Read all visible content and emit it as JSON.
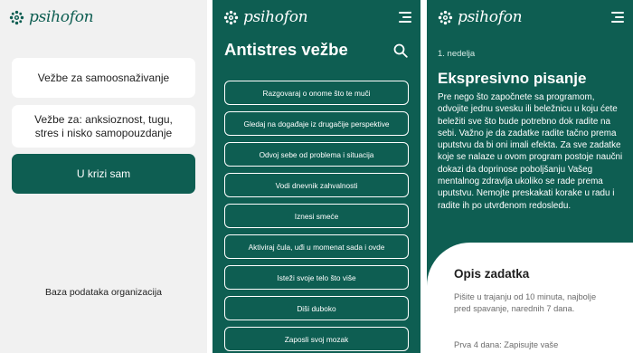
{
  "brand": {
    "name": "psihofon"
  },
  "home": {
    "card_self_help": "Vežbe za samoosnaživanje",
    "card_anxiety": "Vežbe za: anksioznost, tugu, stres i nisko samopouzdanje",
    "card_crisis": "U krizi sam",
    "org_database": "Baza podataka organizacija"
  },
  "stress": {
    "title": "Antistres vežbe",
    "exercises": [
      "Razgovaraj o onome što te muči",
      "Gledaj na događaje iz drugačije perspektive",
      "Odvoj sebe od problema i situacija",
      "Vodi dnevnik zahvalnosti",
      "Iznesi smeće",
      "Aktiviraj čula, uđi u momenat sada i ovde",
      "Isteži svoje telo što više",
      "Diši duboko",
      "Zaposli svoj mozak"
    ]
  },
  "detail": {
    "week": "1. nedelja",
    "title": "Ekspresivno pisanje",
    "body": "Pre nego što započnete sa programom, odvojite jednu svesku ili beležnicu u koju ćete beležiti sve što bude potrebno dok radite na sebi. Važno je da zadatke radite tačno prema uputstvu da bi oni imali efekta. Za sve zadatke koje se nalaze u ovom program postoje naučni dokazi da doprinose poboljšanju Vašeg mentalnog zdravlja ukoliko se rade prema uputstvu. Nemojte preskakati korake u radu i radite ih po utvrđenom redosledu.",
    "task_heading": "Opis zadatka",
    "task_text": "Pišite u trajanju od 10 minuta, najbolje pred spavanje, narednih 7 dana.",
    "task_text2": "Prva 4 dana: Zapisujte vaše"
  },
  "colors": {
    "brand_green": "#0e5e52",
    "background": "#f1f1f1",
    "card": "#ffffff"
  },
  "icons": [
    "logo-flower-icon",
    "menu-icon",
    "search-icon"
  ]
}
